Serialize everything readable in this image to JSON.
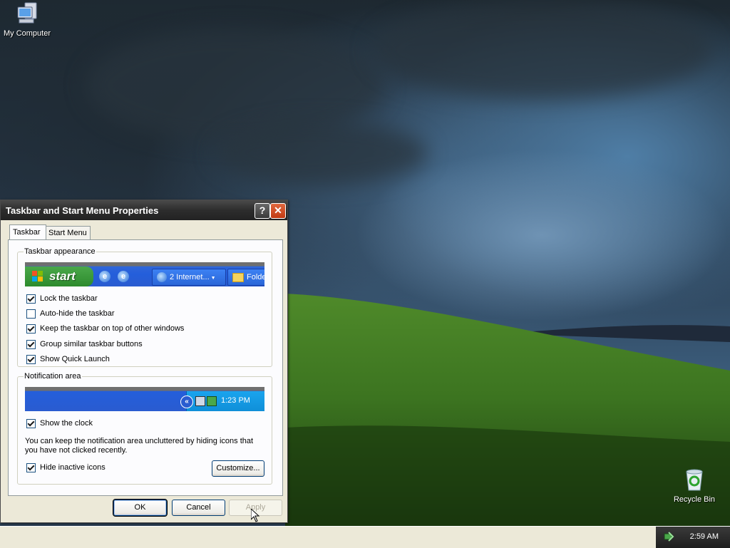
{
  "desktop": {
    "icons": [
      {
        "label": "My Computer",
        "icon": "my-computer-icon"
      },
      {
        "label": "Recycle Bin",
        "icon": "recycle-bin-icon"
      }
    ]
  },
  "dialog": {
    "title": "Taskbar and Start Menu Properties",
    "help_glyph": "?",
    "close_glyph": "✕",
    "tabs": [
      {
        "label": "Taskbar",
        "active": true
      },
      {
        "label": "Start Menu",
        "active": false
      }
    ],
    "appearance": {
      "label": "Taskbar appearance",
      "preview": {
        "start_label": "start",
        "task_buttons": [
          "2 Internet...",
          "Folde"
        ]
      },
      "options": [
        {
          "label": "Lock the taskbar",
          "checked": true
        },
        {
          "label": "Auto-hide the taskbar",
          "checked": false
        },
        {
          "label": "Keep the taskbar on top of other windows",
          "checked": true
        },
        {
          "label": "Group similar taskbar buttons",
          "checked": true
        },
        {
          "label": "Show Quick Launch",
          "checked": true
        }
      ]
    },
    "notification": {
      "label": "Notification area",
      "preview_time": "1:23 PM",
      "chevron_glyph": "«",
      "show_clock": {
        "label": "Show the clock",
        "checked": true
      },
      "note": "You can keep the notification area uncluttered by hiding icons that you have not clicked recently.",
      "hide_inactive": {
        "label": "Hide inactive icons",
        "checked": true
      },
      "customize_label": "Customize..."
    },
    "buttons": {
      "ok": "OK",
      "cancel": "Cancel",
      "apply": "Apply"
    }
  },
  "taskbar": {
    "clock": "2:59 AM"
  },
  "colors": {
    "title_bar": "#2d2d2d",
    "close_button": "#c23a13",
    "dialog_bg": "#ece9d8",
    "preview_blue": "#245edb",
    "start_green": "#3c9a3c"
  }
}
